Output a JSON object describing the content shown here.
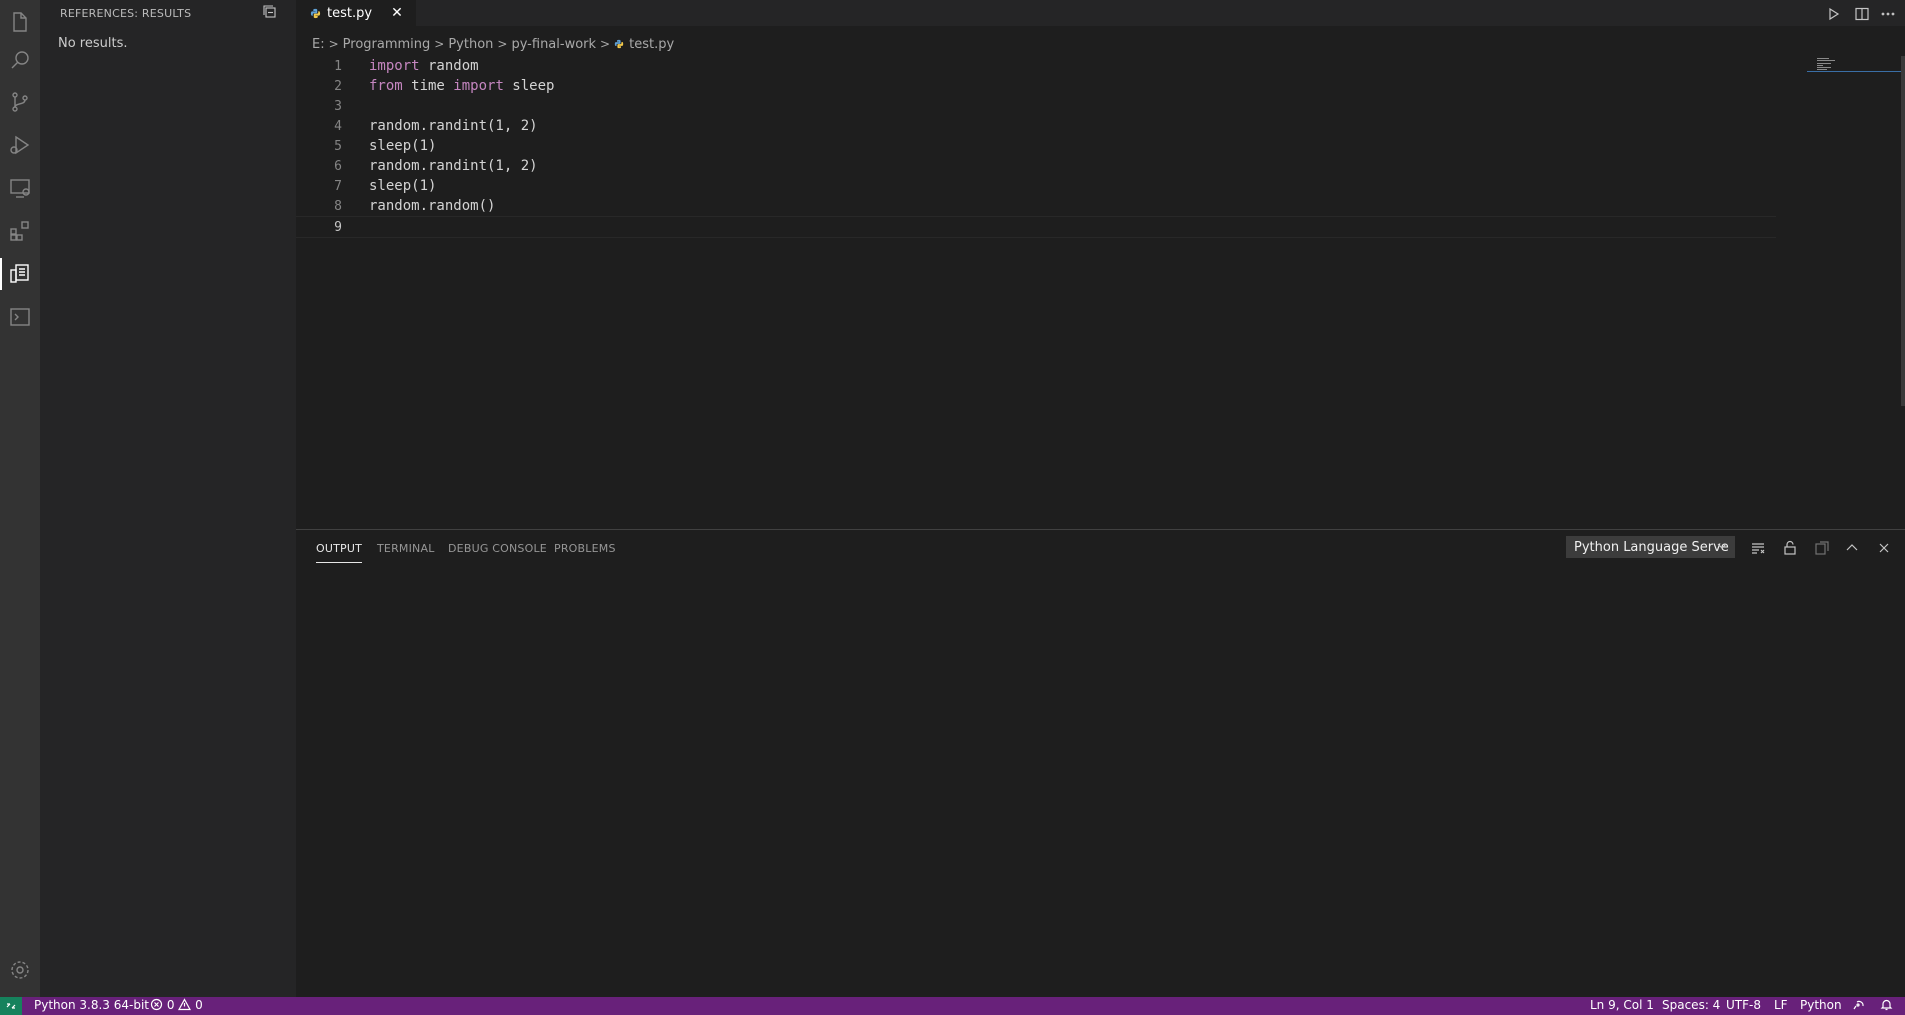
{
  "sidebar": {
    "title": "REFERENCES: RESULTS",
    "message": "No results."
  },
  "tab": {
    "label": "test.py",
    "close": "✕"
  },
  "breadcrumb": [
    "E:",
    "Programming",
    "Python",
    "py-final-work",
    "test.py"
  ],
  "editor": {
    "lines": [
      {
        "n": "1",
        "parts": [
          {
            "t": "import",
            "c": "kw"
          },
          {
            "t": " random",
            "c": ""
          }
        ]
      },
      {
        "n": "2",
        "parts": [
          {
            "t": "from",
            "c": "kw"
          },
          {
            "t": " time ",
            "c": ""
          },
          {
            "t": "import",
            "c": "kw"
          },
          {
            "t": " sleep",
            "c": ""
          }
        ]
      },
      {
        "n": "3",
        "parts": []
      },
      {
        "n": "4",
        "parts": [
          {
            "t": "random.randint(1, 2)",
            "c": ""
          }
        ]
      },
      {
        "n": "5",
        "parts": [
          {
            "t": "sleep(1)",
            "c": ""
          }
        ]
      },
      {
        "n": "6",
        "parts": [
          {
            "t": "random.randint(1, 2)",
            "c": ""
          }
        ]
      },
      {
        "n": "7",
        "parts": [
          {
            "t": "sleep(1)",
            "c": ""
          }
        ]
      },
      {
        "n": "8",
        "parts": [
          {
            "t": "random.random()",
            "c": ""
          }
        ]
      },
      {
        "n": "9",
        "parts": []
      }
    ],
    "current_line": "9"
  },
  "panel": {
    "tabs": [
      "OUTPUT",
      "TERMINAL",
      "DEBUG CONSOLE",
      "PROBLEMS"
    ],
    "active_tab": "OUTPUT",
    "output_channel": "Python Language Serve"
  },
  "status": {
    "interpreter": "Python 3.8.3 64-bit",
    "errors": "0",
    "warnings": "0",
    "position": "Ln 9, Col 1",
    "spaces": "Spaces: 4",
    "encoding": "UTF-8",
    "eol": "LF",
    "language": "Python"
  },
  "colors": {
    "statusbar": "#68217a",
    "remote": "#16825d",
    "keyword": "#c586c0"
  }
}
